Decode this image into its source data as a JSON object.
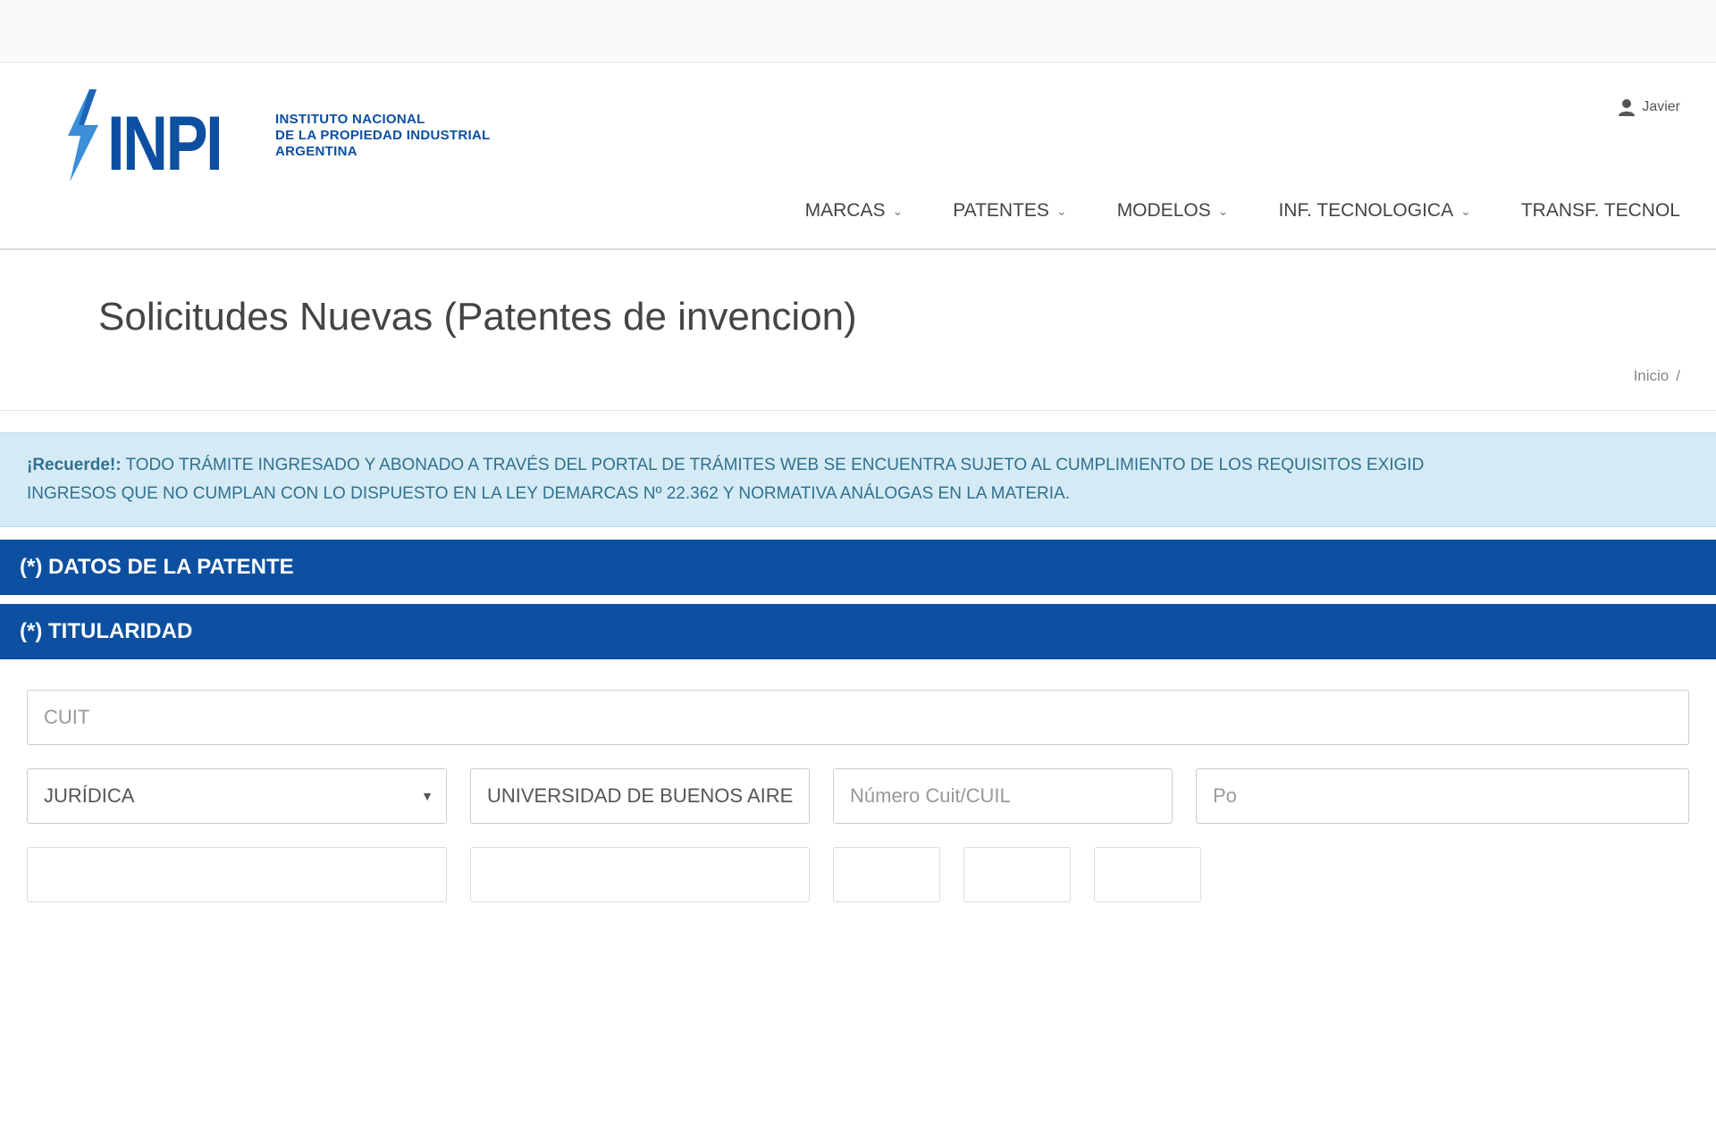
{
  "logo": {
    "word": "INPI",
    "lines": [
      "Instituto Nacional",
      "de la Propiedad Industrial",
      "Argentina"
    ]
  },
  "user": {
    "name": "Javier"
  },
  "nav": {
    "items": [
      {
        "label": "Marcas"
      },
      {
        "label": "Patentes"
      },
      {
        "label": "Modelos"
      },
      {
        "label": "Inf. Tecnologica"
      },
      {
        "label": "Transf. Tecnol"
      }
    ]
  },
  "page": {
    "title": "Solicitudes Nuevas (Patentes de invencion)",
    "breadcrumb": [
      "Inicio",
      "/"
    ]
  },
  "alert": {
    "strong": "¡Recuerde!:",
    "text": "Todo trámite ingresado y abonado a través del portal de trámites web se encuentra sujeto al cumplimiento de los requisitos exigid",
    "text2": "ingresos que no cumplan con lo dispuesto en la Ley DeMarcas Nº 22.362 y normativa análogas en la materia."
  },
  "sections": {
    "datos": "(*) DATOS DE LA PATENTE",
    "titularidad": "(*) TITULARIDAD"
  },
  "form": {
    "cuit_placeholder": "CUIT",
    "tipo_value": "JURÍDICA",
    "razon_social_value": "UNIVERSIDAD DE BUENOS AIRES",
    "numero_placeholder": "Número Cuit/CUIL",
    "extra_placeholder": "Po"
  },
  "colors": {
    "brand": "#0d4fa0",
    "alert_bg": "#d4ebf6",
    "alert_text": "#31708f"
  },
  "icons": {
    "user": "user-icon",
    "chevron": "chevron-down-icon",
    "caret": "caret-down-icon"
  }
}
